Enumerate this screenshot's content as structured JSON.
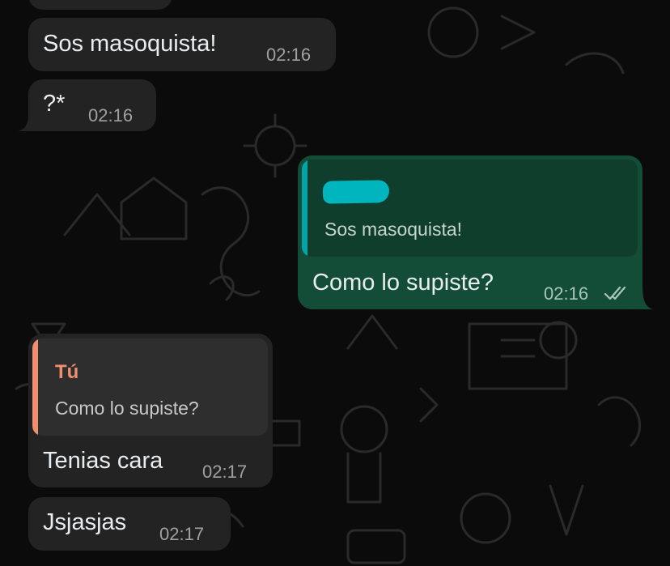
{
  "chat": {
    "messages": [
      {
        "id": "m0",
        "direction": "incoming",
        "text": "",
        "time": ""
      },
      {
        "id": "m1",
        "direction": "incoming",
        "text": "Sos masoquista!",
        "time": "02:16"
      },
      {
        "id": "m2",
        "direction": "incoming",
        "text": "?*",
        "time": "02:16"
      },
      {
        "id": "m3",
        "direction": "outgoing",
        "text": "Como lo supiste?",
        "time": "02:16",
        "status": "read",
        "quote": {
          "author": "",
          "text": "Sos masoquista!",
          "author_redacted": true,
          "bar_color": "#00a5a8"
        }
      },
      {
        "id": "m4",
        "direction": "incoming",
        "text": "Tenias cara",
        "time": "02:17",
        "quote": {
          "author": "Tú",
          "text": "Como lo supiste?",
          "bar_color": "#f08f6d"
        }
      },
      {
        "id": "m5",
        "direction": "incoming",
        "text": "Jsjasjas",
        "time": "02:17"
      }
    ]
  },
  "theme": {
    "incoming_bubble": "#232323",
    "outgoing_bubble": "#134d37",
    "quote_author_you": "#f08f6d",
    "redaction": "#00b5bd"
  },
  "icons": {
    "read_status": "double-check-icon"
  }
}
